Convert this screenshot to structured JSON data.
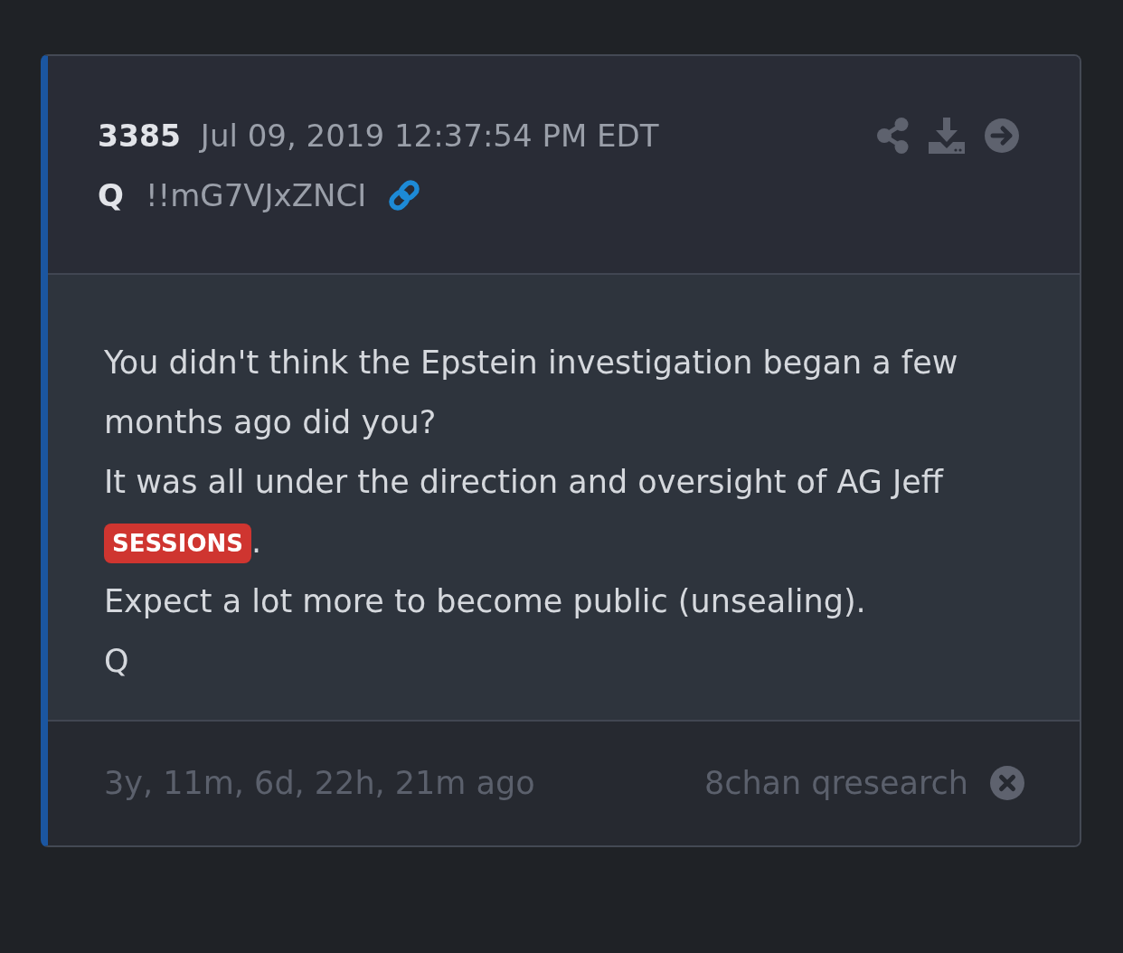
{
  "post": {
    "number": "3385",
    "timestamp": "Jul 09, 2019 12:37:54 PM EDT",
    "author": "Q",
    "tripcode": "!!mG7VJxZNCI"
  },
  "message": [
    [
      {
        "kind": "text",
        "text": "You didn't think the Epstein investigation began a few months ago did you?"
      }
    ],
    [
      {
        "kind": "text",
        "text": "It was all under the direction and oversight of AG Jeff "
      },
      {
        "kind": "tag",
        "text": "SESSIONS"
      },
      {
        "kind": "text",
        "text": "."
      }
    ],
    [
      {
        "kind": "text",
        "text": "Expect a lot more to become public (unsealing)."
      }
    ],
    [
      {
        "kind": "text",
        "text": "Q"
      }
    ]
  ],
  "footer": {
    "age": "3y, 11m, 6d, 22h, 21m ago",
    "source": "8chan qresearch"
  }
}
